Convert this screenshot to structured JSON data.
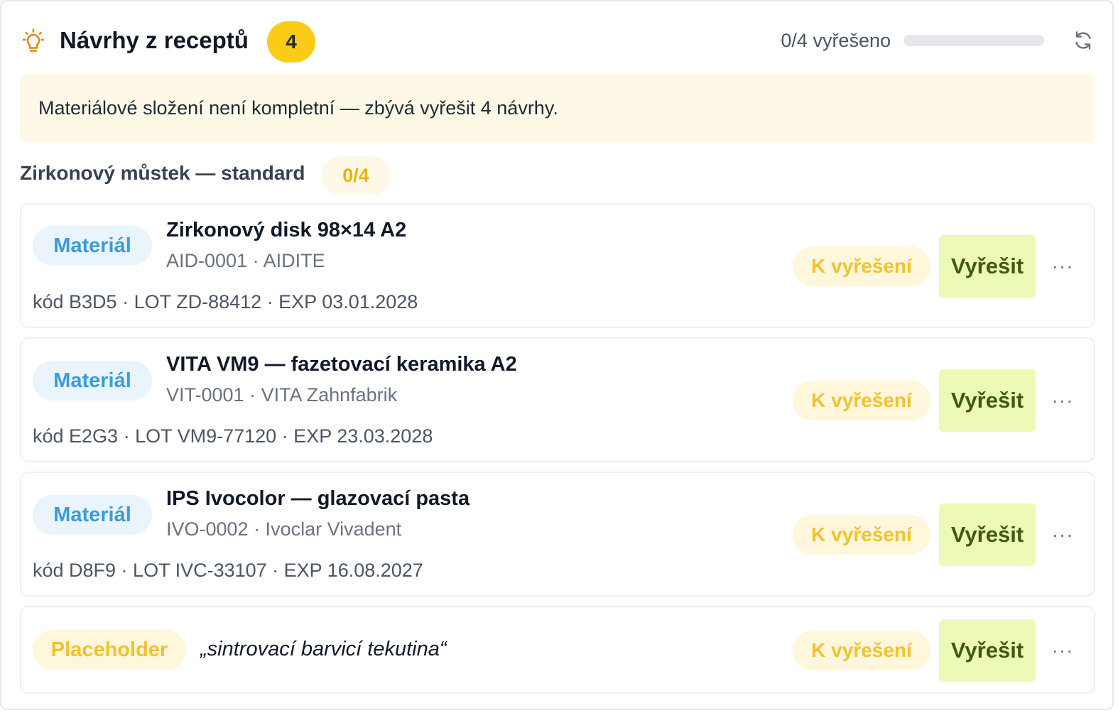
{
  "header": {
    "title": "Návrhy z receptů",
    "count": "4",
    "progress_text": "0/4 vyřešeno",
    "progress_fraction": 0,
    "icon_left": "lightbulb-icon",
    "icon_right": "refresh-icon"
  },
  "warning": {
    "text": "Materiálové složení není kompletní — zbývá vyřešit 4 návrhy."
  },
  "group": {
    "title": "Zirkonový můstek — standard",
    "count": "0/4"
  },
  "items": [
    {
      "type": "Materiál",
      "name": "Zirkonový disk 98×14 A2",
      "sub": "AID-0001 · AIDITE",
      "meta": "kód B3D5 · LOT ZD-88412 · EXP 03.01.2028",
      "status": "K vyřešení",
      "action": "Vyřešit",
      "more": "···"
    },
    {
      "type": "Materiál",
      "name": "VITA VM9 — fazetovací keramika A2",
      "sub": "VIT-0001 · VITA Zahnfabrik",
      "meta": "kód E2G3 · LOT VM9-77120 · EXP 23.03.2028",
      "status": "K vyřešení",
      "action": "Vyřešit",
      "more": "···"
    },
    {
      "type": "Materiál",
      "name": "IPS Ivocolor — glazovací pasta",
      "sub": "IVO-0002 · Ivoclar Vivadent",
      "meta": "kód D8F9 · LOT IVC-33107 · EXP 16.08.2027",
      "status": "K vyřešení",
      "action": "Vyřešit",
      "more": "···"
    },
    {
      "type": "Placeholder",
      "text": "„sintrovací barvicí tekutina“",
      "status": "K vyřešení",
      "action": "Vyřešit",
      "more": "···"
    }
  ],
  "colors": {
    "accent_yellow": "#facc15",
    "material_blue": "#3b9bdc",
    "placeholder_yellow": "#f2c12e",
    "resolve_green_bg": "#ecfab5",
    "resolve_green_text": "#3f5a0f",
    "warning_bg": "#fef9e7"
  }
}
